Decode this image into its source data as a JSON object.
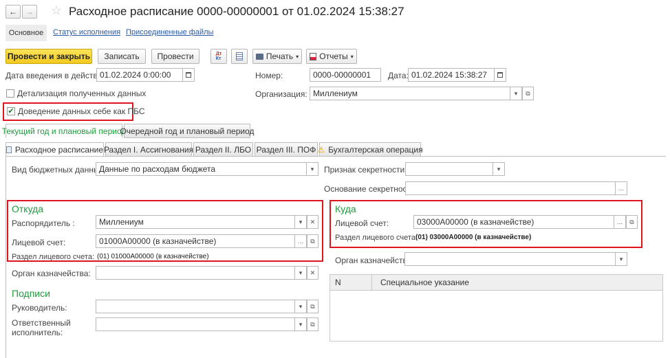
{
  "window": {
    "title": "Расходное расписание 0000-00000001 от 01.02.2024 15:38:27"
  },
  "nav": {
    "back": "←",
    "forward": "→",
    "star": "☆"
  },
  "section_tabs": [
    {
      "label": "Основное"
    },
    {
      "label": "Статус исполнения"
    },
    {
      "label": "Присоединенные файлы"
    }
  ],
  "toolbar": {
    "post_close": "Провести и закрыть",
    "write": "Записать",
    "post": "Провести",
    "print": "Печать",
    "reports": "Отчеты"
  },
  "header": {
    "effective_date_label": "Дата введения в действие:",
    "effective_date": "01.02.2024  0:00:00",
    "number_label": "Номер:",
    "number": "0000-00000001",
    "date_label": "Дата:",
    "date": "01.02.2024 15:38:27",
    "detail_label": "Детализация полученных данных",
    "org_label": "Организация:",
    "org": "Миллениум",
    "self_pbs_label": "Доведение данных себе как ПБС"
  },
  "period_tabs": [
    {
      "label": "Текущий год и плановый период"
    },
    {
      "label": "Очередной год и плановый период"
    }
  ],
  "main_tabs": [
    {
      "label": "Расходное расписание"
    },
    {
      "label": "Раздел I. Ассигнования"
    },
    {
      "label": "Раздел II. ЛБО"
    },
    {
      "label": "Раздел III. ПОФ"
    },
    {
      "label": "Бухгалтерская операция"
    }
  ],
  "form": {
    "budget_type_label": "Вид бюджетных данных:",
    "budget_type": "Данные по расходам бюджета",
    "secrecy_label": "Признак секретности:",
    "secrecy": "",
    "secrecy_basis_label": "Основание секретности:",
    "secrecy_basis": "",
    "from": {
      "title": "Откуда",
      "manager_label": "Распорядитель :",
      "manager": "Миллениум",
      "account_label": "Лицевой счет:",
      "account": "01000A00000 (в казначействе)",
      "section_label": "Раздел лицевого счета:",
      "section_value": "(01) 01000A00000 (в казначействе)"
    },
    "treasury_label": "Орган казначейства:",
    "treasury": "",
    "to": {
      "title": "Куда",
      "account_label": "Лицевой счет:",
      "account": "03000A00000 (в казначействе)",
      "section_label": "Раздел лицевого счета:",
      "section_value": "(01) 03000A00000 (в казначействе)"
    },
    "to_treasury_label": "Орган казначейства:",
    "to_treasury": "",
    "signatures": {
      "title": "Подписи",
      "head_label": "Руководитель:",
      "head": "",
      "executor_label_1": "Ответственный",
      "executor_label_2": "исполнитель:",
      "executor": ""
    },
    "grid": {
      "col_n": "N",
      "col_special": "Специальное указание"
    }
  },
  "colors": {
    "accent_yellow": "#f2c91f",
    "highlight_red": "#e0141e",
    "group_green": "#1f9a3c",
    "link_blue": "#2a5aa6"
  }
}
